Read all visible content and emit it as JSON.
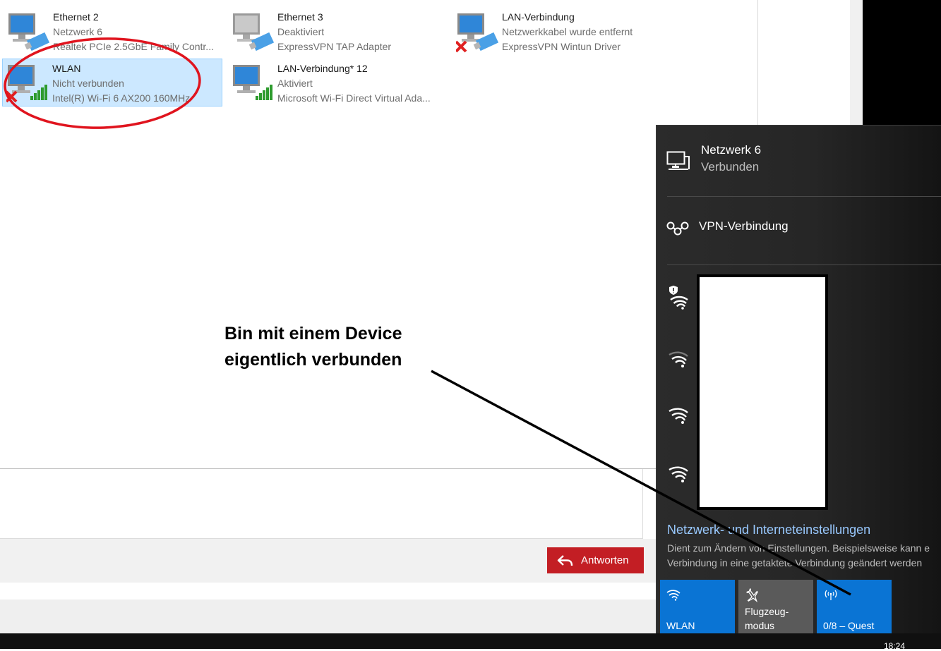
{
  "adapters": [
    {
      "name": "Ethernet 2",
      "status": "Netzwerk 6",
      "device": "Realtek PCIe 2.5GbE Family Contr...",
      "type": "ethernet",
      "state": "connected"
    },
    {
      "name": "Ethernet 3",
      "status": "Deaktiviert",
      "device": "ExpressVPN TAP Adapter",
      "type": "ethernet",
      "state": "disabled"
    },
    {
      "name": "LAN-Verbindung",
      "status": "Netzwerkkabel wurde entfernt",
      "device": "ExpressVPN Wintun Driver",
      "type": "ethernet",
      "state": "error"
    },
    {
      "name": "WLAN",
      "status": "Nicht verbunden",
      "device": "Intel(R) Wi-Fi 6 AX200 160MHz",
      "type": "wifi",
      "state": "error"
    },
    {
      "name": "LAN-Verbindung* 12",
      "status": "Aktiviert",
      "device": "Microsoft Wi-Fi Direct Virtual Ada...",
      "type": "wifi",
      "state": "connected"
    }
  ],
  "forum": {
    "reply_label": "Antworten"
  },
  "annotation": {
    "line1": "Bin mit einem Device",
    "line2": "eigentlich verbunden"
  },
  "flyout": {
    "connection": {
      "name": "Netzwerk 6",
      "status": "Verbunden"
    },
    "vpn_label": "VPN-Verbindung",
    "settings_link": "Netzwerk- und Interneteinstellungen",
    "settings_desc_line1": "Dient zum Ändern von Einstellungen. Beispielsweise kann e",
    "settings_desc_line2": "Verbindung in eine getaktete Verbindung geändert werden",
    "quick_actions": {
      "wlan": "WLAN",
      "flight_line1": "Flugzeug-",
      "flight_line2": "modus",
      "hotspot": "0/8 – Quest"
    }
  },
  "taskbar": {
    "clock": "18:24"
  },
  "colors": {
    "selection": "#cce8ff",
    "reply_button": "#c31e24",
    "accent": "#0a74d4",
    "link": "#99c9ff",
    "circle": "#e0141e"
  }
}
